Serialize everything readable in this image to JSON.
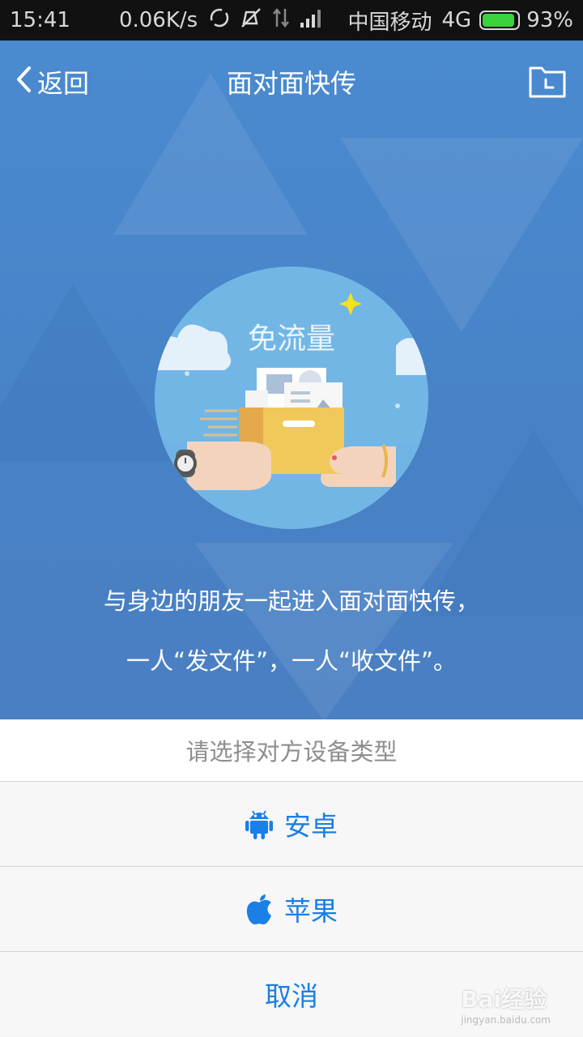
{
  "status_bar": {
    "time": "15:41",
    "speed": "0.06K/s",
    "carrier": "中国移动",
    "network": "4G",
    "battery": "93%",
    "battery_level": 0.93
  },
  "header": {
    "back_label": "返回",
    "title": "面对面快传",
    "right_icon": "folder-clock-icon"
  },
  "illustration": {
    "label": "免流量"
  },
  "description": {
    "line1": "与身边的朋友一起进入面对面快传，",
    "line2": "一人“发文件”，一人“收文件”。"
  },
  "sheet": {
    "title": "请选择对方设备类型",
    "options": [
      {
        "label": "安卓",
        "icon": "android-icon"
      },
      {
        "label": "苹果",
        "icon": "apple-icon"
      }
    ],
    "cancel": "取消"
  },
  "watermark": {
    "brand": "Bai经验",
    "url": "jingyan.baidu.com"
  },
  "colors": {
    "accent": "#1a7fe6",
    "header_bg": "#4a86c8",
    "circle": "#72b6e6"
  }
}
